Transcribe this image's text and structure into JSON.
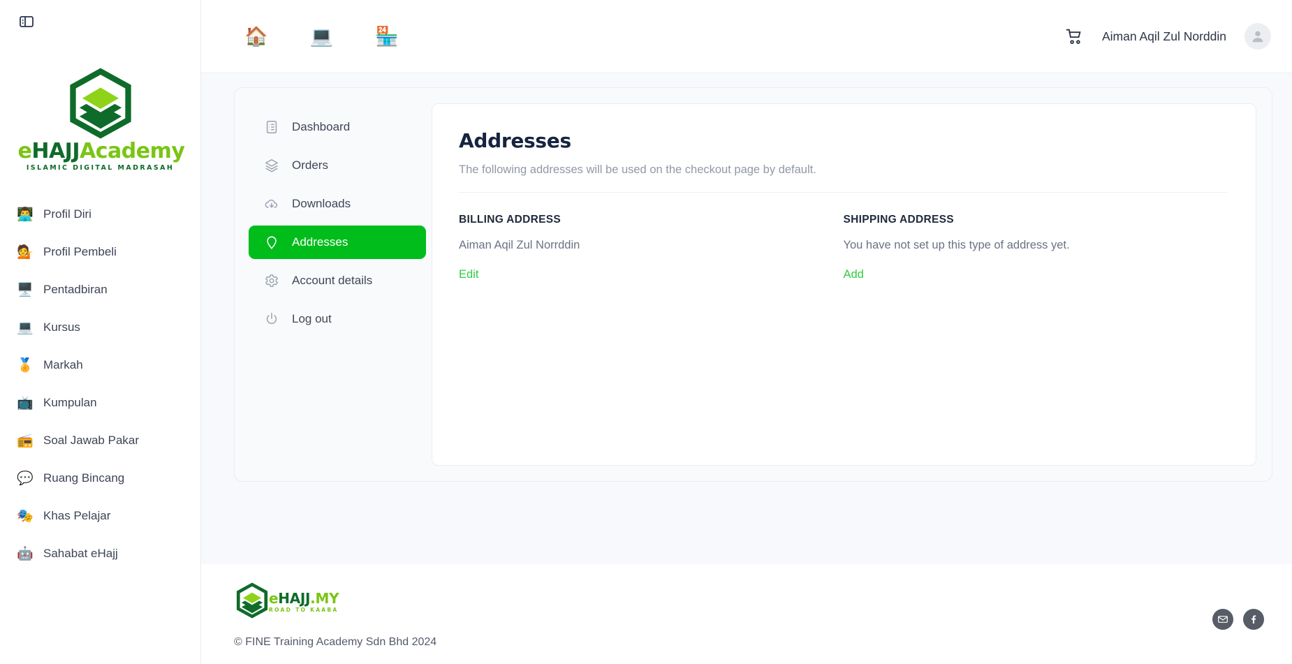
{
  "sidebar": {
    "toggle_icon": "panel-toggle-icon",
    "logo": {
      "icon": "kaaba-logo-icon",
      "word_e": "e",
      "word_hajj": "HAJJ",
      "word_academy": "Academy",
      "tagline": "ISLAMIC DIGITAL MADRASAH"
    },
    "items": [
      {
        "label": "Profil Diri",
        "emoji": "👨‍💻",
        "icon": "profil-diri-icon"
      },
      {
        "label": "Profil Pembeli",
        "emoji": "💁",
        "icon": "profil-pembeli-icon"
      },
      {
        "label": "Pentadbiran",
        "emoji": "🖥️",
        "icon": "pentadbiran-icon"
      },
      {
        "label": "Kursus",
        "emoji": "💻",
        "icon": "kursus-icon"
      },
      {
        "label": "Markah",
        "emoji": "🏅",
        "icon": "markah-icon"
      },
      {
        "label": "Kumpulan",
        "emoji": "📺",
        "icon": "kumpulan-icon"
      },
      {
        "label": "Soal Jawab Pakar",
        "emoji": "📻",
        "icon": "soal-jawab-pakar-icon"
      },
      {
        "label": "Ruang Bincang",
        "emoji": "💬",
        "icon": "ruang-bincang-icon"
      },
      {
        "label": "Khas Pelajar",
        "emoji": "🎭",
        "icon": "khas-pelajar-icon"
      },
      {
        "label": "Sahabat eHajj",
        "emoji": "🤖",
        "icon": "sahabat-ehajj-icon"
      }
    ]
  },
  "topbar": {
    "nav_icons": [
      {
        "name": "home-icon",
        "emoji": "🏠"
      },
      {
        "name": "elearning-icon",
        "emoji": "💻"
      },
      {
        "name": "store-icon",
        "emoji": "🏪"
      }
    ],
    "cart_icon": "shopping-cart-icon",
    "user_name": "Aiman Aqil Zul Norddin",
    "avatar_icon": "user-avatar-icon"
  },
  "account_nav": {
    "items": [
      {
        "label": "Dashboard",
        "icon": "dashboard-icon",
        "active": false
      },
      {
        "label": "Orders",
        "icon": "orders-layers-icon",
        "active": false
      },
      {
        "label": "Downloads",
        "icon": "download-cloud-icon",
        "active": false
      },
      {
        "label": "Addresses",
        "icon": "location-pin-icon",
        "active": true
      },
      {
        "label": "Account details",
        "icon": "gear-icon",
        "active": false
      },
      {
        "label": "Log out",
        "icon": "power-icon",
        "active": false
      }
    ],
    "active_bg": "#00bd1b"
  },
  "main": {
    "title": "Addresses",
    "subtitle": "The following addresses will be used on the checkout page by default.",
    "billing": {
      "heading": "BILLING ADDRESS",
      "value": "Aiman Aqil Zul Norrddin",
      "action": "Edit"
    },
    "shipping": {
      "heading": "SHIPPING ADDRESS",
      "value": "You have not set up this type of address yet.",
      "action": "Add"
    },
    "link_color": "#2ecc40"
  },
  "footer": {
    "logo": {
      "icon": "kaaba-logo-icon",
      "word_e": "e",
      "word_hajj": "HAJJ",
      "word_my": ".MY",
      "tagline": "ROAD TO KAABA"
    },
    "copyright": "© FINE Training Academy Sdn Bhd 2024",
    "socials": [
      {
        "name": "email-icon",
        "glyph": "✉"
      },
      {
        "name": "facebook-icon",
        "glyph": "f"
      }
    ]
  }
}
